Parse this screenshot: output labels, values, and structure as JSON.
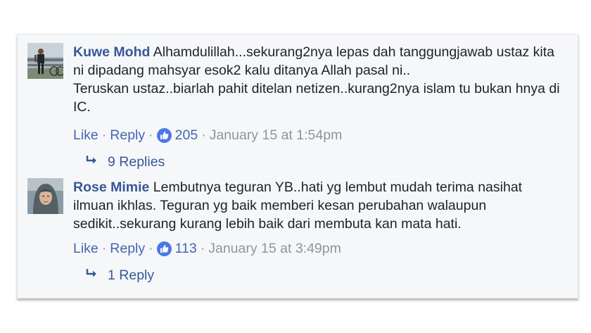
{
  "comments": [
    {
      "author": "Kuwe Mohd",
      "text": "Alhamdulillah...sekurang2nya lepas dah tanggungjawab ustaz kita ni dipadang mahsyar esok2 kalu ditanya Allah pasal ni..\nTeruskan ustaz..biarlah pahit ditelan netizen..kurang2nya islam tu bukan hnya di IC.",
      "like_label": "Like",
      "reply_label": "Reply",
      "like_count": "205",
      "timestamp": "January 15 at 1:54pm",
      "replies_label": "9 Replies",
      "avatar_icon": "man-standing-photo"
    },
    {
      "author": "Rose Mimie",
      "text": "Lembutnya teguran YB..hati yg lembut mudah terima nasihat ilmuan ikhlas. Teguran yg baik memberi kesan perubahan walaupun sedikit..sekurang kurang lebih baik dari membuta kan mata hati.",
      "like_label": "Like",
      "reply_label": "Reply",
      "like_count": "113",
      "timestamp": "January 15 at 3:49pm",
      "replies_label": "1 Reply",
      "avatar_icon": "woman-hijab-photo"
    }
  ],
  "separator": "·",
  "colors": {
    "author": "#365899",
    "link": "#4267b2",
    "meta": "#90949c",
    "text": "#1d2129",
    "like_badge": "#4a78e8",
    "card_bg": "#f6f7f9"
  }
}
